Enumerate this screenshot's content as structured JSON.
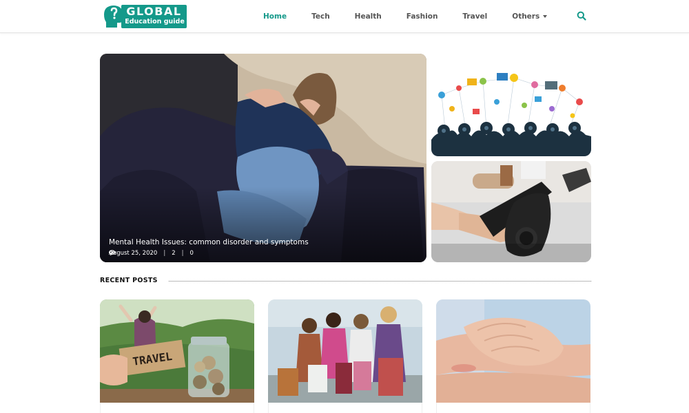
{
  "brand": {
    "name": "GLOBAL",
    "tagline": "Education guide",
    "color": "#14998a"
  },
  "nav": {
    "items": [
      {
        "label": "Home",
        "active": true
      },
      {
        "label": "Tech"
      },
      {
        "label": "Health"
      },
      {
        "label": "Fashion"
      },
      {
        "label": "Travel"
      },
      {
        "label": "Others",
        "dropdown": true
      }
    ],
    "search_icon": "search-icon"
  },
  "featured": {
    "main": {
      "title": "Mental Health Issues: common disorder and symptoms",
      "date": "August 25, 2020",
      "views": "2",
      "comments": "0"
    }
  },
  "recent": {
    "heading": "RECENT POSTS"
  },
  "cards": [
    {
      "image_text": "TRAVEL"
    },
    {},
    {}
  ]
}
